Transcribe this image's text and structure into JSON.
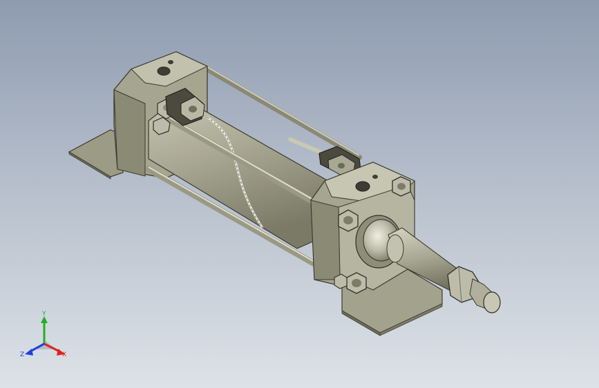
{
  "viewport": {
    "background_top": "#8e9bb0",
    "background_bottom": "#dde2e8"
  },
  "model": {
    "part_color": "#a6a58f",
    "part_dark": "#6f6e5c",
    "part_light": "#c9c8b4",
    "nut_color": "#bdbcaa"
  },
  "triad": {
    "x_label": "X",
    "y_label": "Y",
    "z_label": "Z",
    "x_color": "#e02020",
    "y_color": "#20b020",
    "z_color": "#2040e0"
  }
}
